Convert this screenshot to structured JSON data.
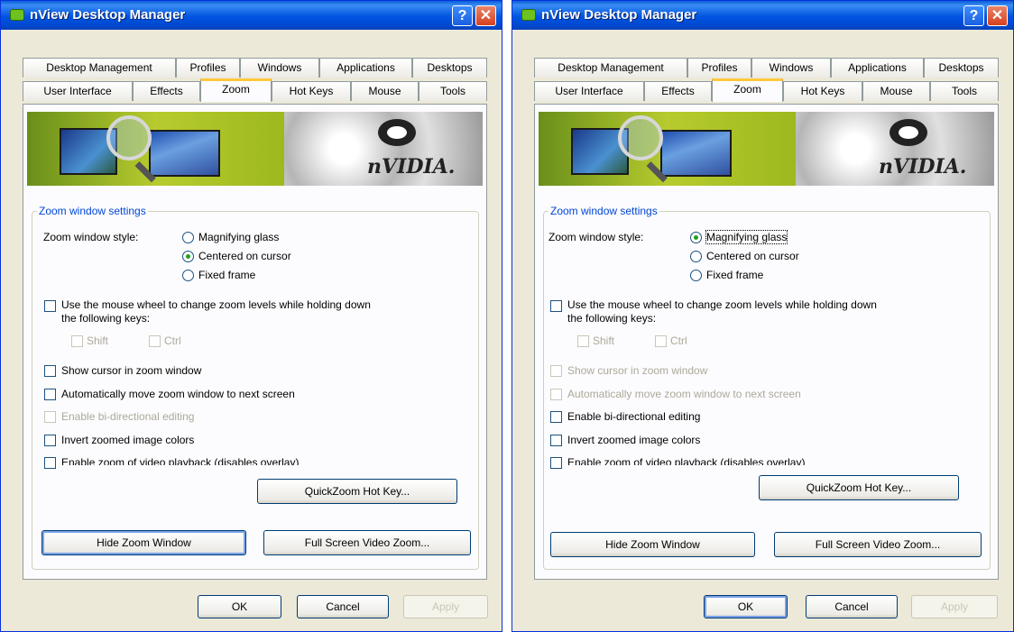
{
  "dialogs": [
    {
      "title": "nView Desktop Manager",
      "help_glyph": "?",
      "close_glyph": "✕",
      "tabs_row1": [
        "Desktop Management",
        "Profiles",
        "Windows",
        "Applications",
        "Desktops"
      ],
      "tabs_row2": [
        "User Interface",
        "Effects",
        "Zoom",
        "Hot Keys",
        "Mouse",
        "Tools"
      ],
      "active_tab": "Zoom",
      "banner_brand": "nVIDIA.",
      "group_title": "Zoom window settings",
      "zoom_style_label": "Zoom window style:",
      "radio_options": [
        "Magnifying glass",
        "Centered on cursor",
        "Fixed frame"
      ],
      "selected_radio": "Centered on cursor",
      "wheel_line1": "Use the mouse wheel to change zoom levels while holding down",
      "wheel_line2": "the following keys:",
      "shift_label": "Shift",
      "ctrl_label": "Ctrl",
      "show_cursor": "Show cursor in zoom window",
      "auto_move": "Automatically move zoom window to next screen",
      "bidirectional": "Enable bi-directional editing",
      "invert": "Invert zoomed image colors",
      "video_zoom": "Enable zoom of video playback (disables overlay)",
      "quickzoom_button": "QuickZoom Hot Key...",
      "hide_button": "Hide Zoom Window",
      "fullscreen_button": "Full Screen Video Zoom...",
      "ok": "OK",
      "cancel": "Cancel",
      "apply": "Apply"
    },
    {
      "title": "nView Desktop Manager",
      "help_glyph": "?",
      "close_glyph": "✕",
      "tabs_row1": [
        "Desktop Management",
        "Profiles",
        "Windows",
        "Applications",
        "Desktops"
      ],
      "tabs_row2": [
        "User Interface",
        "Effects",
        "Zoom",
        "Hot Keys",
        "Mouse",
        "Tools"
      ],
      "active_tab": "Zoom",
      "banner_brand": "nVIDIA.",
      "group_title": "Zoom window settings",
      "zoom_style_label": "Zoom window style:",
      "radio_options": [
        "Magnifying glass",
        "Centered on cursor",
        "Fixed frame"
      ],
      "selected_radio": "Magnifying glass",
      "wheel_line1": "Use the mouse wheel to change zoom levels while holding down",
      "wheel_line2": "the following keys:",
      "shift_label": "Shift",
      "ctrl_label": "Ctrl",
      "show_cursor": "Show cursor in zoom window",
      "auto_move": "Automatically move zoom window to next screen",
      "bidirectional": "Enable bi-directional editing",
      "invert": "Invert zoomed image colors",
      "video_zoom": "Enable zoom of video playback (disables overlay)",
      "quickzoom_button": "QuickZoom Hot Key...",
      "hide_button": "Hide Zoom Window",
      "fullscreen_button": "Full Screen Video Zoom...",
      "ok": "OK",
      "cancel": "Cancel",
      "apply": "Apply"
    }
  ],
  "colors": {
    "title_bar": "#0053e1",
    "group_title": "#0046d5",
    "active_tab_accent": "#ffc83c",
    "radio_dot": "#21a121",
    "disabled_text": "#aca899"
  }
}
